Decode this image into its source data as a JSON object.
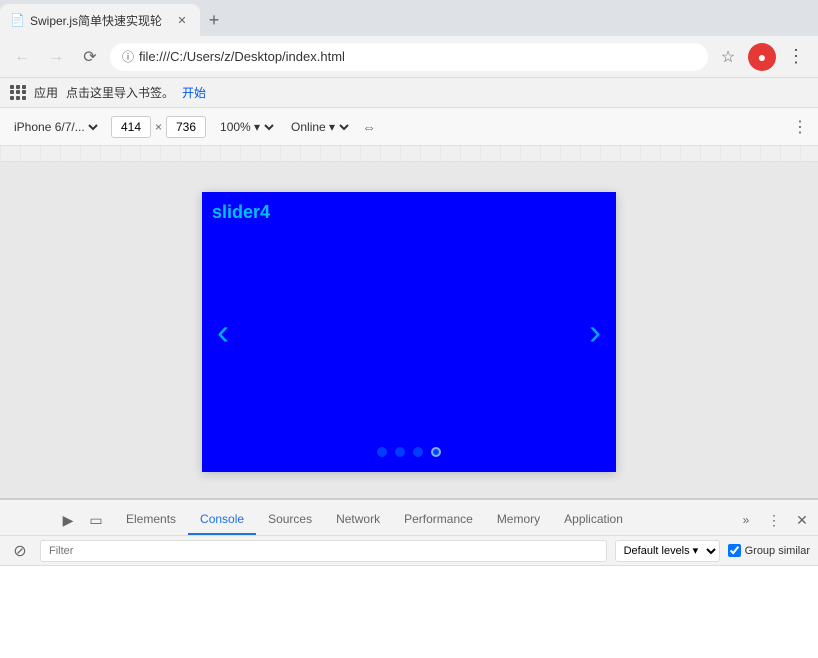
{
  "browser": {
    "tab": {
      "title": "Swiper.js简单快速实现轮",
      "favicon": "📄"
    },
    "address": "file:///C:/Users/z/Desktop/index.html",
    "bookmarks": {
      "apps_label": "应用",
      "prompt": "点击这里导入书签。",
      "link": "开始"
    }
  },
  "device_toolbar": {
    "device": "iPhone 6/7/...",
    "width": "414",
    "height": "736",
    "zoom": "100%",
    "network": "Online"
  },
  "slider": {
    "label": "slider4",
    "dots": [
      {
        "active": false
      },
      {
        "active": false
      },
      {
        "active": false
      },
      {
        "active": true
      }
    ]
  },
  "devtools": {
    "tabs": [
      {
        "label": "Elements",
        "active": false
      },
      {
        "label": "Console",
        "active": true
      },
      {
        "label": "Sources",
        "active": false
      },
      {
        "label": "Network",
        "active": false
      },
      {
        "label": "Performance",
        "active": false
      },
      {
        "label": "Memory",
        "active": false
      },
      {
        "label": "Application",
        "active": false
      }
    ],
    "toolbar": {
      "filter_placeholder": "Filter",
      "level_label": "Default levels",
      "group_similar_label": "Group similar"
    }
  }
}
